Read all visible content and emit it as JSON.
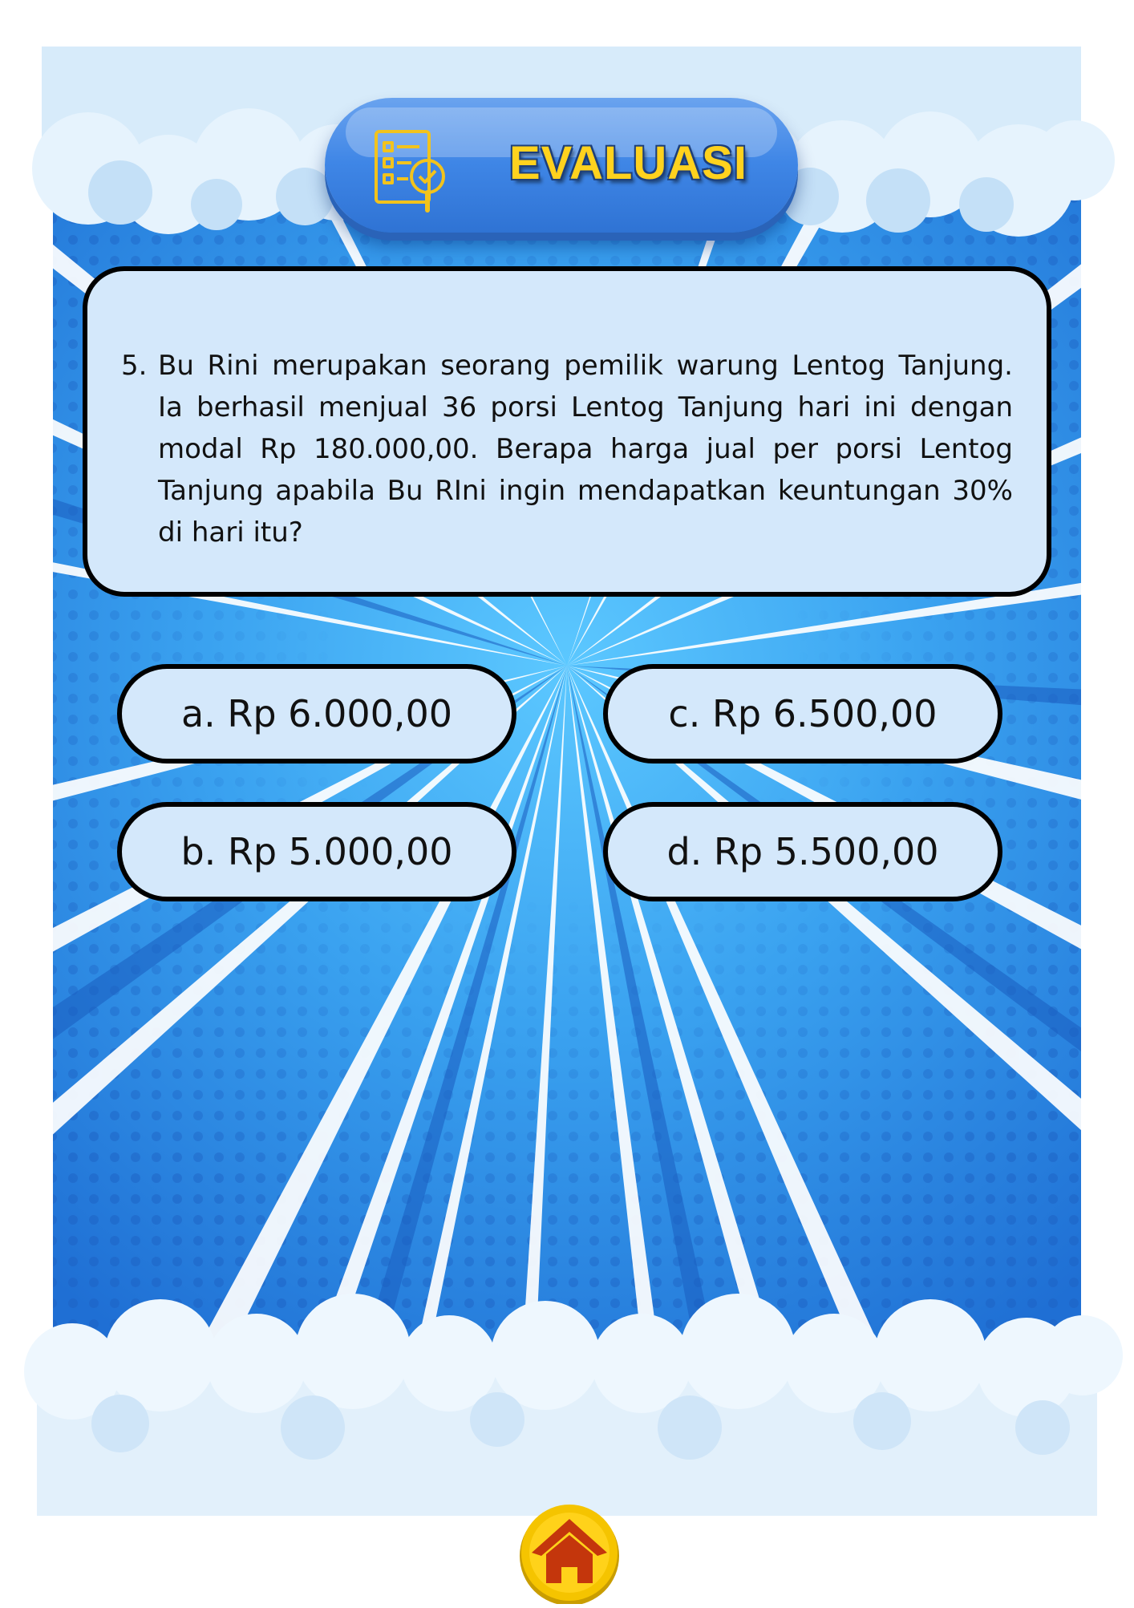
{
  "header": {
    "title": "EVALUASI",
    "icon": "checklist-magnifier-icon"
  },
  "question": {
    "number": "5.",
    "text": "Bu Rini merupakan seorang pemilik warung Lentog Tanjung. Ia berhasil menjual 36 porsi Lentog Tanjung hari ini dengan modal Rp 180.000,00. Berapa harga jual per porsi Lentog Tanjung apabila Bu RIni ingin mendapatkan keuntungan 30% di hari itu?"
  },
  "options": {
    "a": "a. Rp 6.000,00",
    "b": "b. Rp 5.000,00",
    "c": "c. Rp 6.500,00",
    "d": "d. Rp 5.500,00"
  },
  "footer": {
    "home_icon": "home-icon"
  },
  "colors": {
    "sky_blue": "#3b9ae8",
    "card_fill": "#d4e8fb",
    "title_text": "#ffd21e",
    "home_button": "#f5c400",
    "home_house": "#c4360c"
  }
}
